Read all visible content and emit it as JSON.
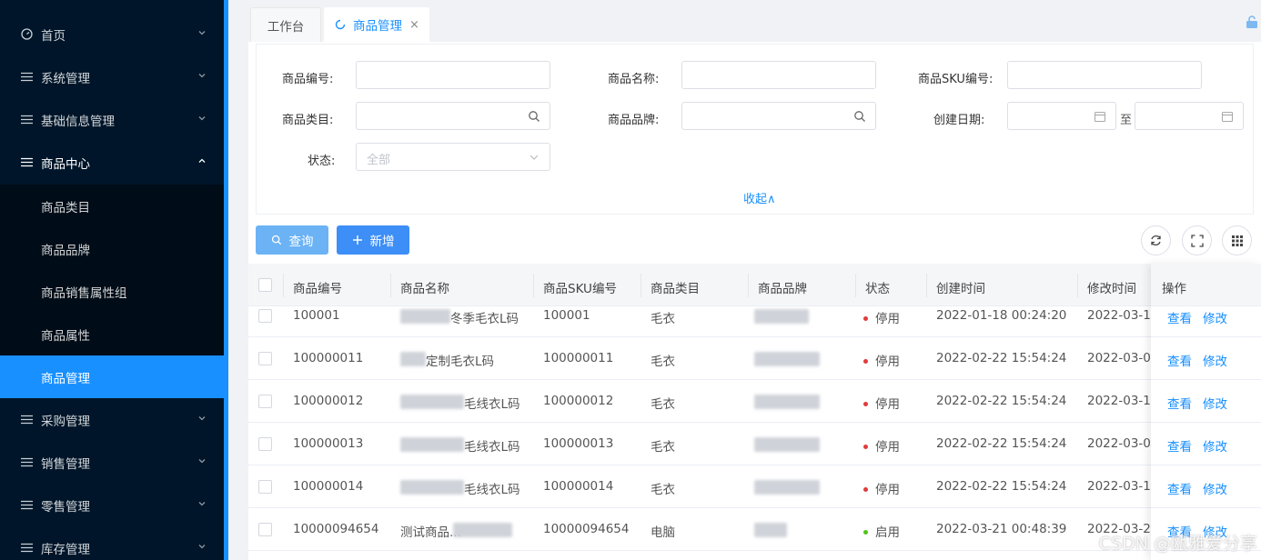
{
  "sidebar": {
    "menu": [
      {
        "label": "首页",
        "icon": "dashboard-icon"
      },
      {
        "label": "系统管理",
        "icon": "list-icon"
      },
      {
        "label": "基础信息管理",
        "icon": "list-icon"
      },
      {
        "label": "商品中心",
        "icon": "list-icon",
        "expanded": true
      }
    ],
    "submenu": [
      {
        "label": "商品类目"
      },
      {
        "label": "商品品牌"
      },
      {
        "label": "商品销售属性组"
      },
      {
        "label": "商品属性"
      },
      {
        "label": "商品管理",
        "active": true
      }
    ],
    "menu_bottom": [
      {
        "label": "采购管理"
      },
      {
        "label": "销售管理"
      },
      {
        "label": "零售管理"
      },
      {
        "label": "库存管理"
      }
    ]
  },
  "tabs": {
    "home": "工作台",
    "active": "商品管理",
    "close": "×"
  },
  "search": {
    "code_label": "商品编号:",
    "name_label": "商品名称:",
    "sku_label": "商品SKU编号:",
    "category_label": "商品类目:",
    "brand_label": "商品品牌:",
    "created_label": "创建日期:",
    "range_sep": "至",
    "status_label": "状态:",
    "status_value": "全部",
    "collapse": "收起∧"
  },
  "actions": {
    "query": "查询",
    "add": "新增"
  },
  "table": {
    "headers": {
      "code": "商品编号",
      "name": "商品名称",
      "sku": "商品SKU编号",
      "category": "商品类目",
      "brand": "商品品牌",
      "status": "状态",
      "created": "创建时间",
      "modified": "修改时间",
      "ops": "操作"
    },
    "rows": [
      {
        "code": "100001",
        "name": "冬季毛衣L码",
        "sku": "100001",
        "category": "毛衣",
        "status": "停用",
        "created": "2022-01-18 00:24:20",
        "modified": "2022-03-1"
      },
      {
        "code": "100000011",
        "name": "定制毛衣L码",
        "sku": "100000011",
        "category": "毛衣",
        "status": "停用",
        "created": "2022-02-22 15:54:24",
        "modified": "2022-03-0"
      },
      {
        "code": "100000012",
        "name": "毛线衣L码",
        "sku": "100000012",
        "category": "毛衣",
        "status": "停用",
        "created": "2022-02-22 15:54:24",
        "modified": "2022-03-1"
      },
      {
        "code": "100000013",
        "name": "毛线衣L码",
        "sku": "100000013",
        "category": "毛衣",
        "status": "停用",
        "created": "2022-02-22 15:54:24",
        "modified": "2022-03-0"
      },
      {
        "code": "100000014",
        "name": "毛线衣L码",
        "sku": "100000014",
        "category": "毛衣",
        "status": "停用",
        "created": "2022-02-22 15:54:24",
        "modified": "2022-03-1"
      },
      {
        "code": "10000094654",
        "name": "测试商品...",
        "sku": "10000094654",
        "category": "电脑",
        "status": "启用",
        "created": "2022-03-21 00:48:39",
        "modified": "2022-03-2"
      }
    ],
    "view": "查看",
    "edit": "修改"
  },
  "colors": {
    "sidebar_bg": "#001529",
    "accent": "#1890ff",
    "status_stopped": "#e23b3b",
    "status_enabled": "#52c41a"
  },
  "watermark": "CSDN @瓯雅爱分享"
}
